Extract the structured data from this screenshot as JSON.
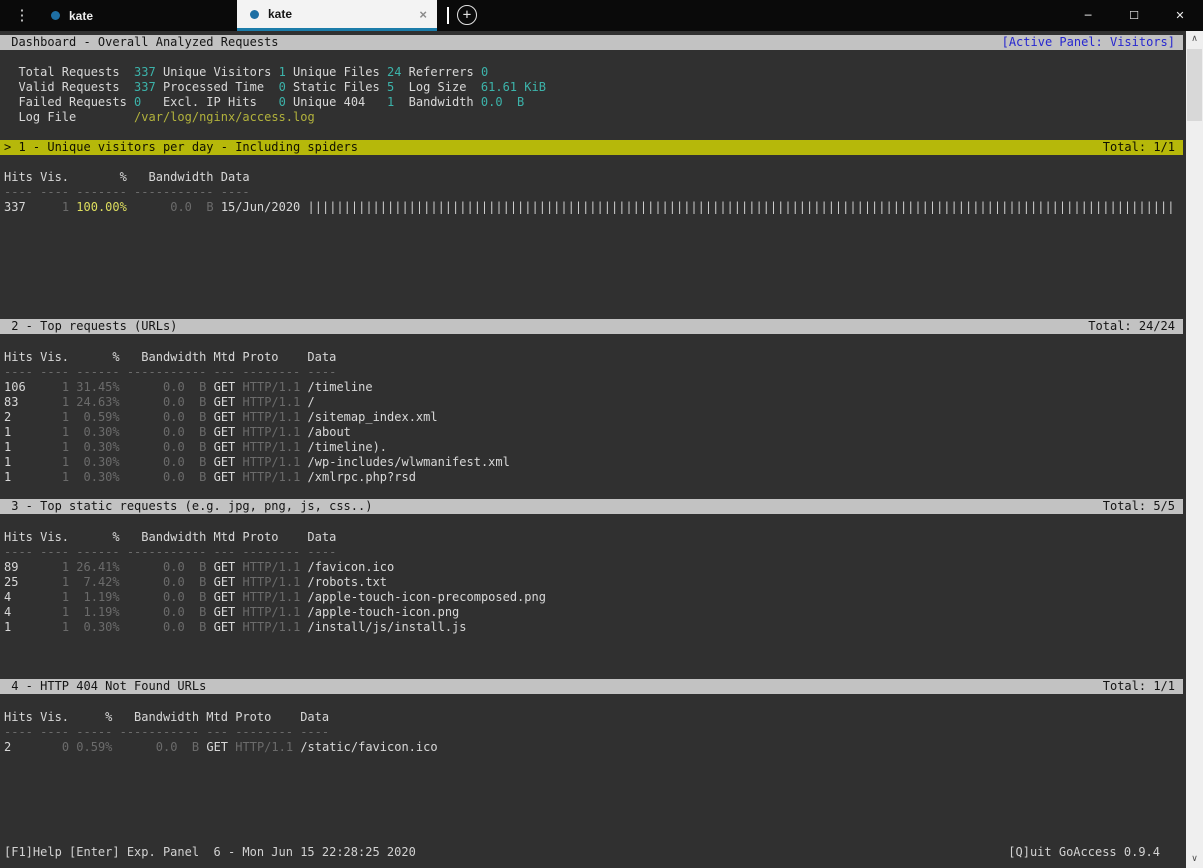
{
  "window": {
    "menu_icon": "⋮",
    "tabs": [
      {
        "label": "kate",
        "active": false
      },
      {
        "label": "kate",
        "active": true,
        "close_icon": "×"
      }
    ],
    "new_tab_icon": "+",
    "controls": {
      "minimize": "─",
      "maximize": "☐",
      "close": "✕"
    }
  },
  "header_bar": {
    "title": " Dashboard - Overall Analyzed Requests",
    "active_panel": "[Active Panel: Visitors]"
  },
  "summary": {
    "lines": [
      [
        [
          "  Total Requests  ",
          "l"
        ],
        [
          "337",
          "v"
        ],
        [
          " ",
          "l"
        ],
        [
          "Unique Visitors",
          "l"
        ],
        [
          " ",
          "l"
        ],
        [
          "1",
          "v"
        ],
        [
          " ",
          "l"
        ],
        [
          "Unique Files",
          "l"
        ],
        [
          " ",
          "l"
        ],
        [
          "24",
          "v"
        ],
        [
          " ",
          "l"
        ],
        [
          "Referrers",
          "l"
        ],
        [
          " ",
          "l"
        ],
        [
          "0",
          "v"
        ]
      ],
      [
        [
          "  Valid Requests  ",
          "l"
        ],
        [
          "337",
          "v"
        ],
        [
          " Processed Time  ",
          "l"
        ],
        [
          "0",
          "v"
        ],
        [
          " Static Files ",
          "l"
        ],
        [
          "5",
          "v"
        ],
        [
          "  Log Size  ",
          "l"
        ],
        [
          "61.61 KiB",
          "v"
        ]
      ],
      [
        [
          "  Failed Requests ",
          "l"
        ],
        [
          "0",
          "v"
        ],
        [
          "   Excl. IP Hits   ",
          "l"
        ],
        [
          "0",
          "v"
        ],
        [
          " Unique 404   ",
          "l"
        ],
        [
          "1",
          "v"
        ],
        [
          "  Bandwidth ",
          "l"
        ],
        [
          "0.0",
          "v"
        ],
        [
          "  ",
          "l"
        ],
        [
          "B",
          "v"
        ]
      ],
      [
        [
          "  Log File        ",
          "l"
        ],
        [
          "/var/log/nginx/access.log",
          "p"
        ]
      ]
    ]
  },
  "panels": [
    {
      "title": "> 1 - Unique visitors per day - Including spiders",
      "total": "Total: 1/1",
      "active": true,
      "pct_width": 7,
      "has_method": false,
      "columns": [
        "Hits",
        "Vis.",
        "%",
        "Bandwidth",
        "Data"
      ],
      "rows": [
        {
          "hits": "337",
          "vis": "1",
          "pct": "100.00%",
          "bw": "0.0",
          "unit": "B",
          "data": "15/Jun/2020",
          "bar_char": "|",
          "bar_count": 120
        }
      ]
    },
    {
      "title": " 2 - Top requests (URLs)",
      "total": "Total: 24/24",
      "active": false,
      "pct_width": 6,
      "has_method": true,
      "columns": [
        "Hits",
        "Vis.",
        "%",
        "Bandwidth",
        "Mtd",
        "Proto",
        "Data"
      ],
      "rows": [
        {
          "hits": "106",
          "vis": "1",
          "pct": "31.45%",
          "bw": "0.0",
          "unit": "B",
          "mtd": "GET",
          "proto": "HTTP/1.1",
          "data": "/timeline"
        },
        {
          "hits": "83",
          "vis": "1",
          "pct": "24.63%",
          "bw": "0.0",
          "unit": "B",
          "mtd": "GET",
          "proto": "HTTP/1.1",
          "data": "/"
        },
        {
          "hits": "2",
          "vis": "1",
          "pct": "0.59%",
          "bw": "0.0",
          "unit": "B",
          "mtd": "GET",
          "proto": "HTTP/1.1",
          "data": "/sitemap_index.xml"
        },
        {
          "hits": "1",
          "vis": "1",
          "pct": "0.30%",
          "bw": "0.0",
          "unit": "B",
          "mtd": "GET",
          "proto": "HTTP/1.1",
          "data": "/about"
        },
        {
          "hits": "1",
          "vis": "1",
          "pct": "0.30%",
          "bw": "0.0",
          "unit": "B",
          "mtd": "GET",
          "proto": "HTTP/1.1",
          "data": "/timeline)."
        },
        {
          "hits": "1",
          "vis": "1",
          "pct": "0.30%",
          "bw": "0.0",
          "unit": "B",
          "mtd": "GET",
          "proto": "HTTP/1.1",
          "data": "/wp-includes/wlwmanifest.xml"
        },
        {
          "hits": "1",
          "vis": "1",
          "pct": "0.30%",
          "bw": "0.0",
          "unit": "B",
          "mtd": "GET",
          "proto": "HTTP/1.1",
          "data": "/xmlrpc.php?rsd"
        }
      ]
    },
    {
      "title": " 3 - Top static requests (e.g. jpg, png, js, css..)",
      "total": "Total: 5/5",
      "active": false,
      "pct_width": 6,
      "has_method": true,
      "columns": [
        "Hits",
        "Vis.",
        "%",
        "Bandwidth",
        "Mtd",
        "Proto",
        "Data"
      ],
      "rows": [
        {
          "hits": "89",
          "vis": "1",
          "pct": "26.41%",
          "bw": "0.0",
          "unit": "B",
          "mtd": "GET",
          "proto": "HTTP/1.1",
          "data": "/favicon.ico"
        },
        {
          "hits": "25",
          "vis": "1",
          "pct": "7.42%",
          "bw": "0.0",
          "unit": "B",
          "mtd": "GET",
          "proto": "HTTP/1.1",
          "data": "/robots.txt"
        },
        {
          "hits": "4",
          "vis": "1",
          "pct": "1.19%",
          "bw": "0.0",
          "unit": "B",
          "mtd": "GET",
          "proto": "HTTP/1.1",
          "data": "/apple-touch-icon-precomposed.png"
        },
        {
          "hits": "4",
          "vis": "1",
          "pct": "1.19%",
          "bw": "0.0",
          "unit": "B",
          "mtd": "GET",
          "proto": "HTTP/1.1",
          "data": "/apple-touch-icon.png"
        },
        {
          "hits": "1",
          "vis": "1",
          "pct": "0.30%",
          "bw": "0.0",
          "unit": "B",
          "mtd": "GET",
          "proto": "HTTP/1.1",
          "data": "/install/js/install.js"
        }
      ]
    },
    {
      "title": " 4 - HTTP 404 Not Found URLs",
      "total": "Total: 1/1",
      "active": false,
      "pct_width": 5,
      "has_method": true,
      "columns": [
        "Hits",
        "Vis.",
        "%",
        "Bandwidth",
        "Mtd",
        "Proto",
        "Data"
      ],
      "rows": [
        {
          "hits": "2",
          "vis": "0",
          "pct": "0.59%",
          "bw": "0.0",
          "unit": "B",
          "mtd": "GET",
          "proto": "HTTP/1.1",
          "data": "/static/favicon.ico"
        }
      ]
    }
  ],
  "statusbar": {
    "left": "[F1]Help [Enter] Exp. Panel  6 - Mon Jun 15 22:28:25 2020",
    "right": "[Q]uit GoAccess 0.9.4"
  },
  "scrollbar": {
    "up_icon": "∧",
    "down_icon": "∨"
  },
  "colors": {
    "terminal_bg": "#303030",
    "bar_gray_bg": "#c2c2c2",
    "bar_active_bg": "#b6b80a",
    "active_panel_blue": "#2626d0",
    "value_cyan": "#3cb3aa",
    "path_yellow": "#b2b23c",
    "pct_yellow": "#dede5e",
    "tab_underline": "#1b7ca9",
    "tab_dot": "#1e6fa4"
  }
}
